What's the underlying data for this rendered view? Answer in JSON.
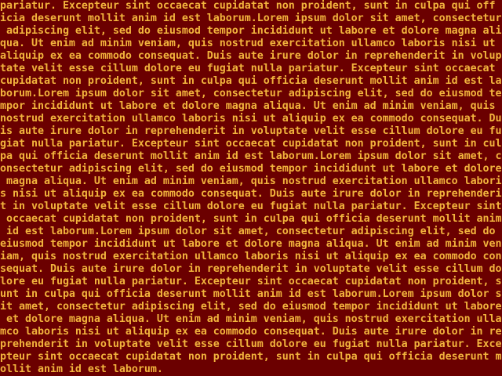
{
  "screen": {
    "background": "#6b0000",
    "foreground": "#f2b43d",
    "lines": [
      "pariatur. Excepteur sint occaecat cupidatat non proident, sunt in culpa qui off",
      "icia deserunt mollit anim id est laborum.Lorem ipsum dolor sit amet, consectetur",
      " adipiscing elit, sed do eiusmod tempor incididunt ut labore et dolore magna ali",
      "qua. Ut enim ad minim veniam, quis nostrud exercitation ullamco laboris nisi ut",
      "aliquip ex ea commodo consequat. Duis aute irure dolor in reprehenderit in volup",
      "tate velit esse cillum dolore eu fugiat nulla pariatur. Excepteur sint occaecat",
      "cupidatat non proident, sunt in culpa qui officia deserunt mollit anim id est la",
      "borum.Lorem ipsum dolor sit amet, consectetur adipiscing elit, sed do eiusmod te",
      "mpor incididunt ut labore et dolore magna aliqua. Ut enim ad minim veniam, quis",
      "nostrud exercitation ullamco laboris nisi ut aliquip ex ea commodo consequat. Du",
      "is aute irure dolor in reprehenderit in voluptate velit esse cillum dolore eu fu",
      "giat nulla pariatur. Excepteur sint occaecat cupidatat non proident, sunt in cul",
      "pa qui officia deserunt mollit anim id est laborum.Lorem ipsum dolor sit amet, c",
      "onsectetur adipiscing elit, sed do eiusmod tempor incididunt ut labore et dolore",
      " magna aliqua. Ut enim ad minim veniam, quis nostrud exercitation ullamco labori",
      "s nisi ut aliquip ex ea commodo consequat. Duis aute irure dolor in reprehenderi",
      "t in voluptate velit esse cillum dolore eu fugiat nulla pariatur. Excepteur sint",
      " occaecat cupidatat non proident, sunt in culpa qui officia deserunt mollit anim",
      " id est laborum.Lorem ipsum dolor sit amet, consectetur adipiscing elit, sed do",
      "eiusmod tempor incididunt ut labore et dolore magna aliqua. Ut enim ad minim ven",
      "iam, quis nostrud exercitation ullamco laboris nisi ut aliquip ex ea commodo con",
      "sequat. Duis aute irure dolor in reprehenderit in voluptate velit esse cillum do",
      "lore eu fugiat nulla pariatur. Excepteur sint occaecat cupidatat non proident, s",
      "unt in culpa qui officia deserunt mollit anim id est laborum.Lorem ipsum dolor s",
      "it amet, consectetur adipiscing elit, sed do eiusmod tempor incididunt ut labore",
      " et dolore magna aliqua. Ut enim ad minim veniam, quis nostrud exercitation ulla",
      "mco laboris nisi ut aliquip ex ea commodo consequat. Duis aute irure dolor in re",
      "prehenderit in voluptate velit esse cillum dolore eu fugiat nulla pariatur. Exce",
      "pteur sint occaecat cupidatat non proident, sunt in culpa qui officia deserunt m",
      "ollit anim id est laborum."
    ]
  }
}
